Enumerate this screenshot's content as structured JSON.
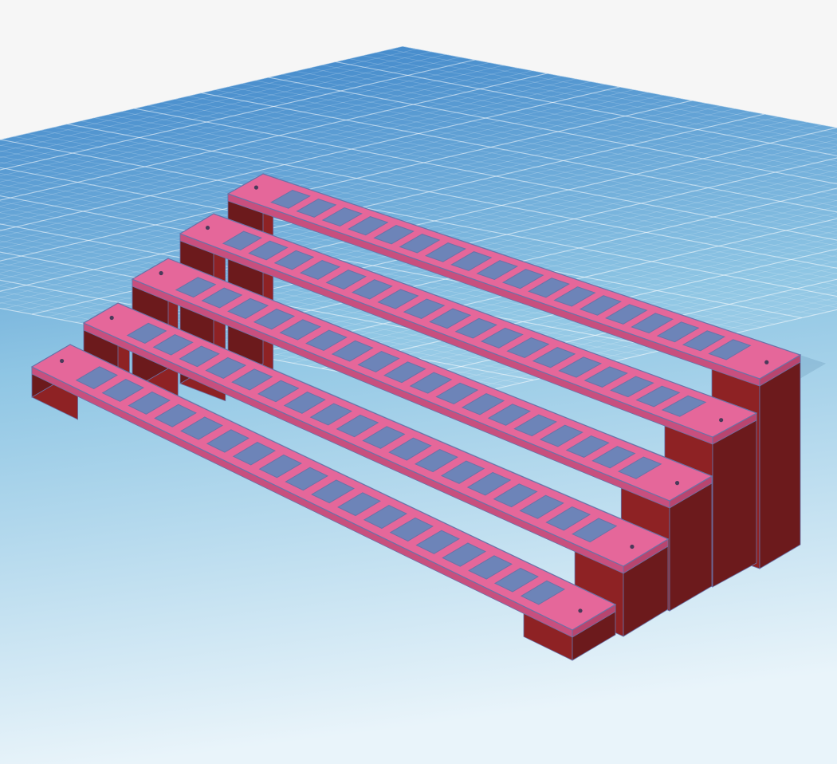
{
  "scene": {
    "background_color": "#f6f6f6",
    "workplane": {
      "grid": true,
      "color_far": "#3a82c8",
      "color_near": "#e9f4fa",
      "line_color": "#ffffff"
    },
    "object": {
      "kind": "stepped-rack",
      "tier_count": 5,
      "openings_per_tier": [
        18,
        18,
        18,
        18,
        18
      ],
      "top_color": "#e5679a",
      "top_edge_color": "#6a72a8",
      "support_color": "#8e2224",
      "support_dark_color": "#6c1a1c",
      "hole_inner_color": "#6d84b8"
    },
    "colors": {
      "accent": "#e5679a",
      "support": "#8e2224"
    }
  }
}
